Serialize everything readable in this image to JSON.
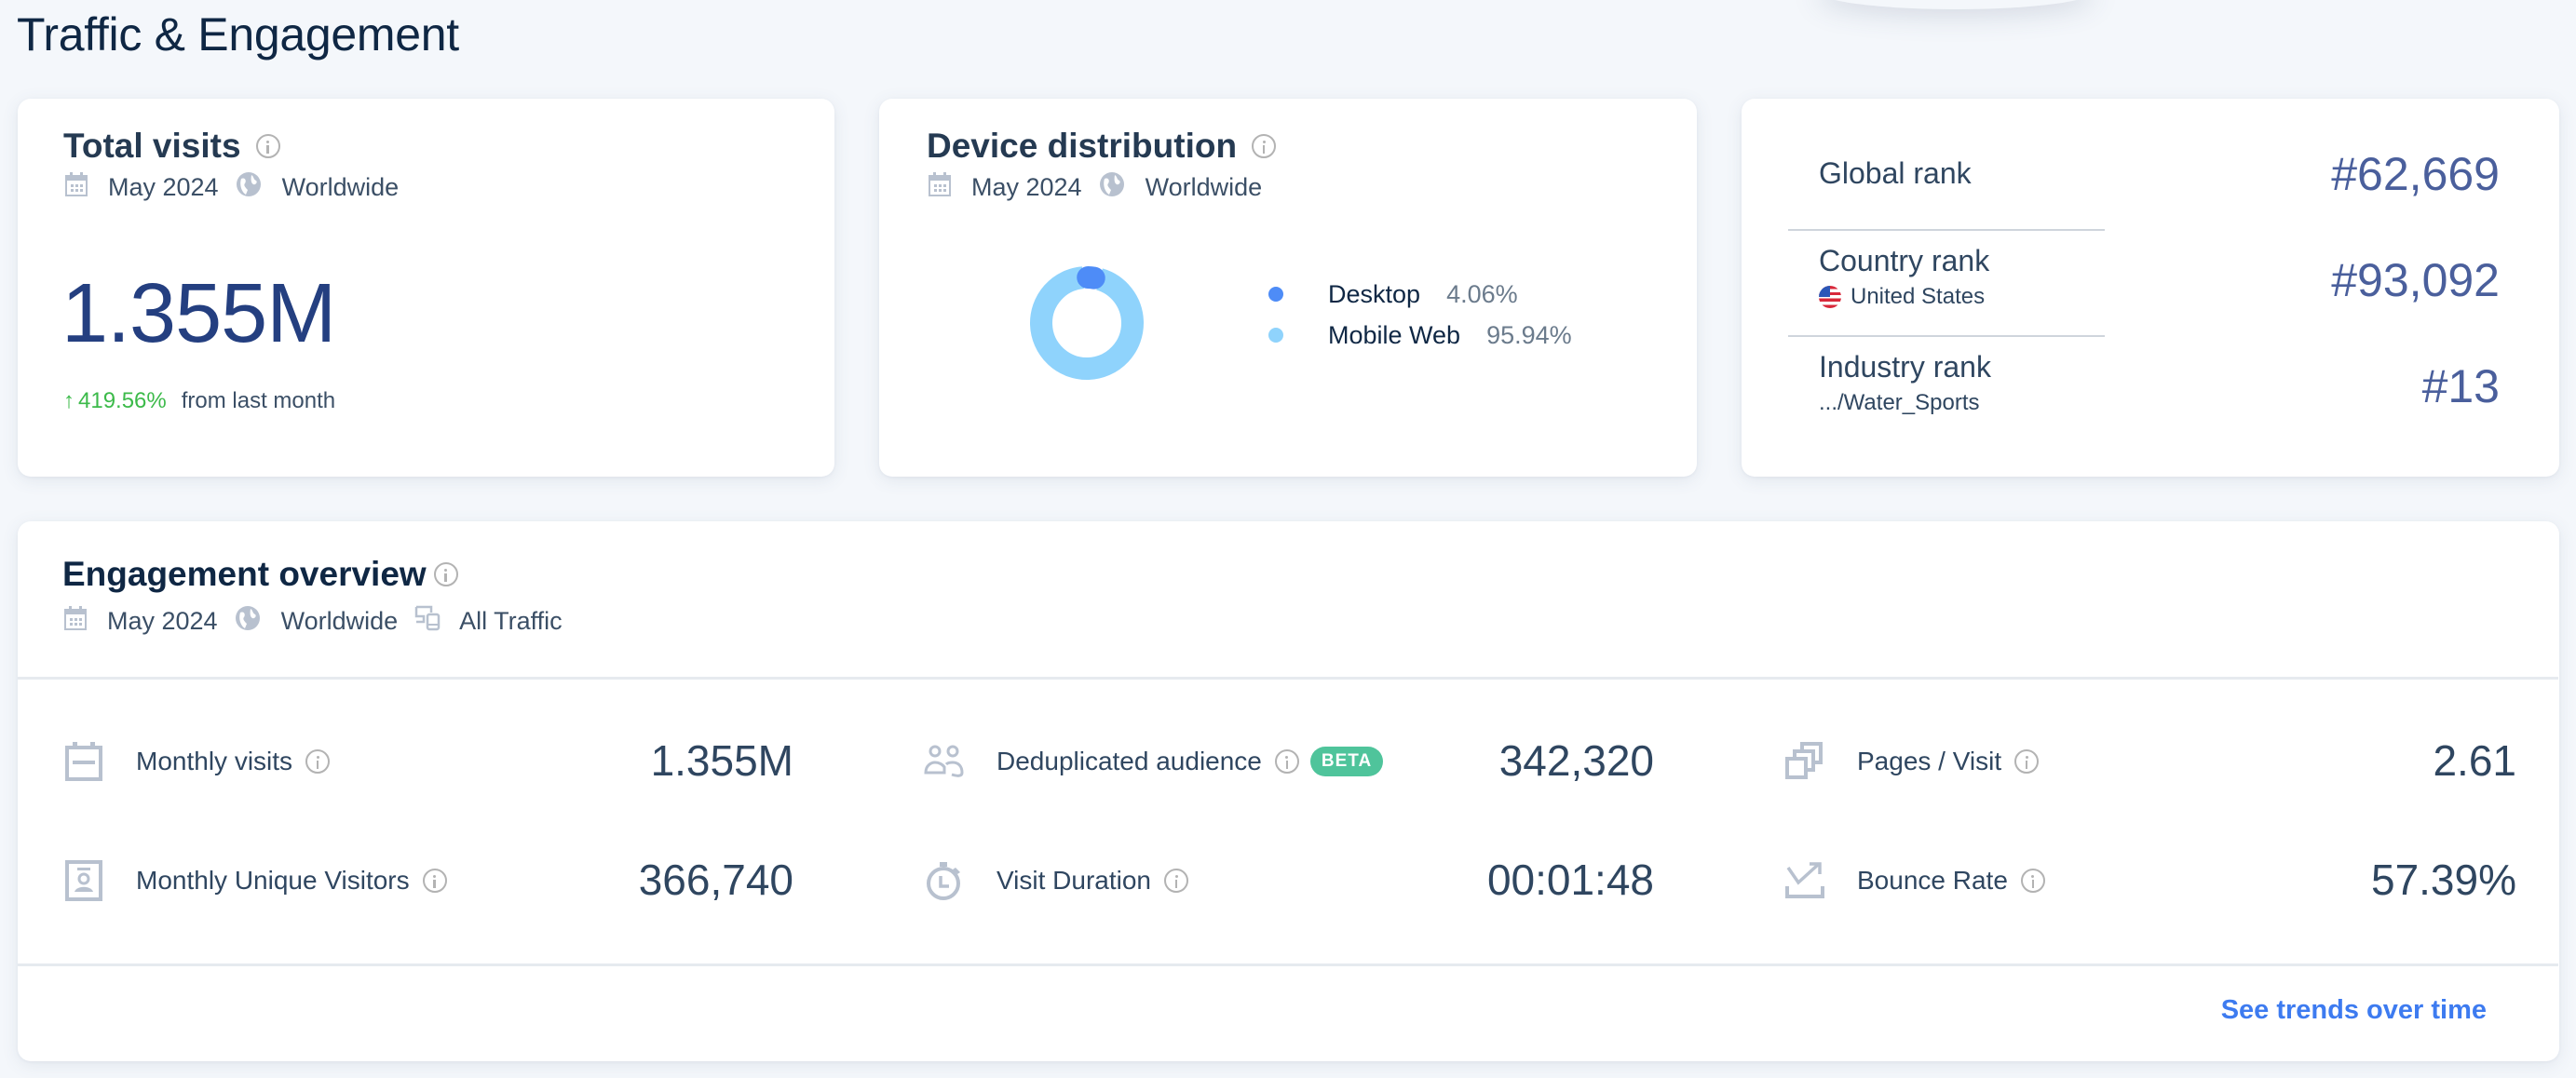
{
  "page": {
    "title": "Traffic & Engagement"
  },
  "total_visits": {
    "title": "Total visits",
    "period": "May 2024",
    "region": "Worldwide",
    "value": "1.355M",
    "change_arrow": "↑",
    "change_pct": "419.56%",
    "change_text": "from last month",
    "change_color": "#3cba4a"
  },
  "device_distribution": {
    "title": "Device distribution",
    "period": "May 2024",
    "region": "Worldwide",
    "segments": [
      {
        "label": "Desktop",
        "value_text": "4.06%",
        "value": 4.06,
        "color": "#4e8cf7"
      },
      {
        "label": "Mobile Web",
        "value_text": "95.94%",
        "value": 95.94,
        "color": "#8fd3fc"
      }
    ]
  },
  "ranks": {
    "global": {
      "label": "Global rank",
      "value": "#62,669"
    },
    "country": {
      "label": "Country rank",
      "sub": "United States",
      "value": "#93,092"
    },
    "industry": {
      "label": "Industry rank",
      "sub": ".../Water_Sports",
      "value": "#13"
    }
  },
  "engagement": {
    "title": "Engagement overview",
    "period": "May 2024",
    "region": "Worldwide",
    "traffic": "All Traffic",
    "metrics": [
      {
        "label": "Monthly visits",
        "value": "1.355M",
        "icon": "calendar-icon"
      },
      {
        "label": "Deduplicated audience",
        "value": "342,320",
        "icon": "audience-icon",
        "badge": "BETA"
      },
      {
        "label": "Pages / Visit",
        "value": "2.61",
        "icon": "pages-icon"
      },
      {
        "label": "Monthly Unique Visitors",
        "value": "366,740",
        "icon": "visitor-badge-icon"
      },
      {
        "label": "Visit Duration",
        "value": "00:01:48",
        "icon": "stopwatch-icon"
      },
      {
        "label": "Bounce Rate",
        "value": "57.39%",
        "icon": "bounce-icon"
      }
    ],
    "badge_color": "#4fc49b",
    "see_trends_label": "See trends over time",
    "link_color": "#3d7bf0"
  }
}
